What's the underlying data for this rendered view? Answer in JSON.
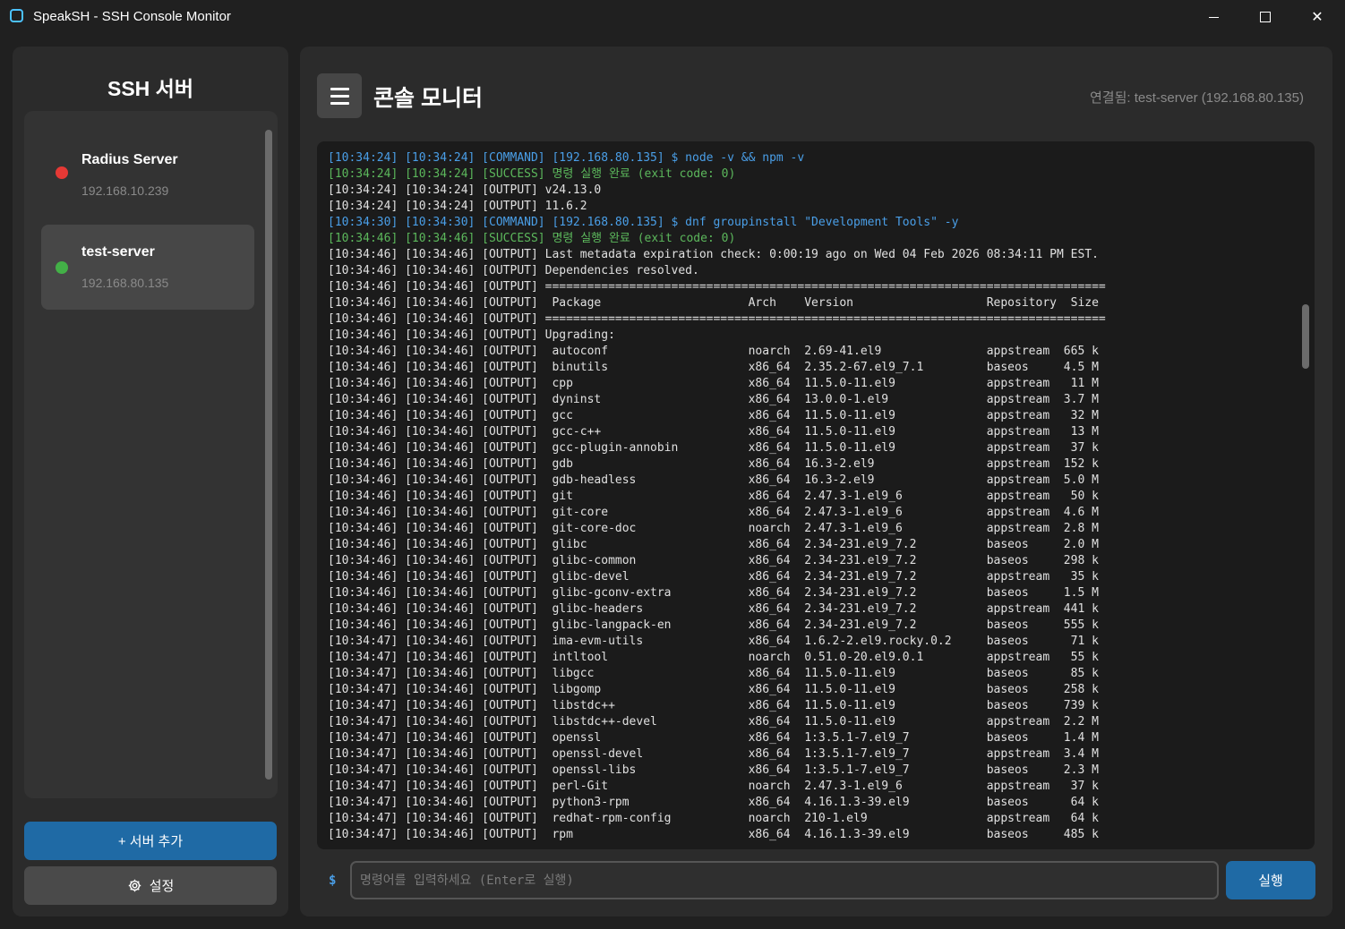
{
  "window": {
    "title": "SpeakSH - SSH Console Monitor",
    "minimize": "",
    "maximize": "",
    "close": "✕"
  },
  "sidebar": {
    "title": "SSH 서버",
    "servers": [
      {
        "name": "Radius Server",
        "ip": "192.168.10.239",
        "status": "disconnected",
        "status_color": "#e53935"
      },
      {
        "name": "test-server",
        "ip": "192.168.80.135",
        "status": "connected",
        "status_color": "#43b047"
      }
    ],
    "add_label": "+ 서버 추가",
    "settings_label": "설정"
  },
  "header": {
    "title": "콘솔 모니터",
    "connection": "연결됨: test-server (192.168.80.135)"
  },
  "console": {
    "lines": [
      {
        "type": "command",
        "text": "[10:34:24] [10:34:24] [COMMAND] [192.168.80.135] $ node -v && npm -v"
      },
      {
        "type": "success",
        "text": "[10:34:24] [10:34:24] [SUCCESS] 명령 실행 완료 (exit code: 0)"
      },
      {
        "type": "output",
        "text": "[10:34:24] [10:34:24] [OUTPUT] v24.13.0"
      },
      {
        "type": "output",
        "text": "[10:34:24] [10:34:24] [OUTPUT] 11.6.2"
      },
      {
        "type": "command",
        "text": "[10:34:30] [10:34:30] [COMMAND] [192.168.80.135] $ dnf groupinstall \"Development Tools\" -y"
      },
      {
        "type": "success",
        "text": "[10:34:46] [10:34:46] [SUCCESS] 명령 실행 완료 (exit code: 0)"
      },
      {
        "type": "output",
        "text": "[10:34:46] [10:34:46] [OUTPUT] Last metadata expiration check: 0:00:19 ago on Wed 04 Feb 2026 08:34:11 PM EST."
      },
      {
        "type": "output",
        "text": "[10:34:46] [10:34:46] [OUTPUT] Dependencies resolved."
      },
      {
        "type": "output",
        "text": "[10:34:46] [10:34:46] [OUTPUT] ================================================================================"
      },
      {
        "type": "output",
        "text": "[10:34:46] [10:34:46] [OUTPUT]  Package                     Arch    Version                   Repository  Size"
      },
      {
        "type": "output",
        "text": "[10:34:46] [10:34:46] [OUTPUT] ================================================================================"
      },
      {
        "type": "output",
        "text": "[10:34:46] [10:34:46] [OUTPUT] Upgrading:"
      },
      {
        "type": "output",
        "text": "[10:34:46] [10:34:46] [OUTPUT]  autoconf                    noarch  2.69-41.el9               appstream  665 k"
      },
      {
        "type": "output",
        "text": "[10:34:46] [10:34:46] [OUTPUT]  binutils                    x86_64  2.35.2-67.el9_7.1         baseos     4.5 M"
      },
      {
        "type": "output",
        "text": "[10:34:46] [10:34:46] [OUTPUT]  cpp                         x86_64  11.5.0-11.el9             appstream   11 M"
      },
      {
        "type": "output",
        "text": "[10:34:46] [10:34:46] [OUTPUT]  dyninst                     x86_64  13.0.0-1.el9              appstream  3.7 M"
      },
      {
        "type": "output",
        "text": "[10:34:46] [10:34:46] [OUTPUT]  gcc                         x86_64  11.5.0-11.el9             appstream   32 M"
      },
      {
        "type": "output",
        "text": "[10:34:46] [10:34:46] [OUTPUT]  gcc-c++                     x86_64  11.5.0-11.el9             appstream   13 M"
      },
      {
        "type": "output",
        "text": "[10:34:46] [10:34:46] [OUTPUT]  gcc-plugin-annobin          x86_64  11.5.0-11.el9             appstream   37 k"
      },
      {
        "type": "output",
        "text": "[10:34:46] [10:34:46] [OUTPUT]  gdb                         x86_64  16.3-2.el9                appstream  152 k"
      },
      {
        "type": "output",
        "text": "[10:34:46] [10:34:46] [OUTPUT]  gdb-headless                x86_64  16.3-2.el9                appstream  5.0 M"
      },
      {
        "type": "output",
        "text": "[10:34:46] [10:34:46] [OUTPUT]  git                         x86_64  2.47.3-1.el9_6            appstream   50 k"
      },
      {
        "type": "output",
        "text": "[10:34:46] [10:34:46] [OUTPUT]  git-core                    x86_64  2.47.3-1.el9_6            appstream  4.6 M"
      },
      {
        "type": "output",
        "text": "[10:34:46] [10:34:46] [OUTPUT]  git-core-doc                noarch  2.47.3-1.el9_6            appstream  2.8 M"
      },
      {
        "type": "output",
        "text": "[10:34:46] [10:34:46] [OUTPUT]  glibc                       x86_64  2.34-231.el9_7.2          baseos     2.0 M"
      },
      {
        "type": "output",
        "text": "[10:34:46] [10:34:46] [OUTPUT]  glibc-common                x86_64  2.34-231.el9_7.2          baseos     298 k"
      },
      {
        "type": "output",
        "text": "[10:34:46] [10:34:46] [OUTPUT]  glibc-devel                 x86_64  2.34-231.el9_7.2          appstream   35 k"
      },
      {
        "type": "output",
        "text": "[10:34:46] [10:34:46] [OUTPUT]  glibc-gconv-extra           x86_64  2.34-231.el9_7.2          baseos     1.5 M"
      },
      {
        "type": "output",
        "text": "[10:34:46] [10:34:46] [OUTPUT]  glibc-headers               x86_64  2.34-231.el9_7.2          appstream  441 k"
      },
      {
        "type": "output",
        "text": "[10:34:46] [10:34:46] [OUTPUT]  glibc-langpack-en           x86_64  2.34-231.el9_7.2          baseos     555 k"
      },
      {
        "type": "output",
        "text": "[10:34:47] [10:34:46] [OUTPUT]  ima-evm-utils               x86_64  1.6.2-2.el9.rocky.0.2     baseos      71 k"
      },
      {
        "type": "output",
        "text": "[10:34:47] [10:34:46] [OUTPUT]  intltool                    noarch  0.51.0-20.el9.0.1         appstream   55 k"
      },
      {
        "type": "output",
        "text": "[10:34:47] [10:34:46] [OUTPUT]  libgcc                      x86_64  11.5.0-11.el9             baseos      85 k"
      },
      {
        "type": "output",
        "text": "[10:34:47] [10:34:46] [OUTPUT]  libgomp                     x86_64  11.5.0-11.el9             baseos     258 k"
      },
      {
        "type": "output",
        "text": "[10:34:47] [10:34:46] [OUTPUT]  libstdc++                   x86_64  11.5.0-11.el9             baseos     739 k"
      },
      {
        "type": "output",
        "text": "[10:34:47] [10:34:46] [OUTPUT]  libstdc++-devel             x86_64  11.5.0-11.el9             appstream  2.2 M"
      },
      {
        "type": "output",
        "text": "[10:34:47] [10:34:46] [OUTPUT]  openssl                     x86_64  1:3.5.1-7.el9_7           baseos     1.4 M"
      },
      {
        "type": "output",
        "text": "[10:34:47] [10:34:46] [OUTPUT]  openssl-devel               x86_64  1:3.5.1-7.el9_7           appstream  3.4 M"
      },
      {
        "type": "output",
        "text": "[10:34:47] [10:34:46] [OUTPUT]  openssl-libs                x86_64  1:3.5.1-7.el9_7           baseos     2.3 M"
      },
      {
        "type": "output",
        "text": "[10:34:47] [10:34:46] [OUTPUT]  perl-Git                    noarch  2.47.3-1.el9_6            appstream   37 k"
      },
      {
        "type": "output",
        "text": "[10:34:47] [10:34:46] [OUTPUT]  python3-rpm                 x86_64  4.16.1.3-39.el9           baseos      64 k"
      },
      {
        "type": "output",
        "text": "[10:34:47] [10:34:46] [OUTPUT]  redhat-rpm-config           noarch  210-1.el9                 appstream   64 k"
      },
      {
        "type": "output",
        "text": "[10:34:47] [10:34:46] [OUTPUT]  rpm                         x86_64  4.16.1.3-39.el9           baseos     485 k"
      }
    ]
  },
  "input": {
    "prompt": "$",
    "value": "",
    "placeholder": "명령어를 입력하세요 (Enter로 실행)",
    "run_label": "실행"
  },
  "colors": {
    "accent": "#1f6aa5",
    "command": "#4a9fe8",
    "success": "#5cb85c",
    "background": "#202020"
  },
  "icons": [
    "app-icon",
    "menu-icon",
    "gear-icon",
    "status-dot"
  ]
}
